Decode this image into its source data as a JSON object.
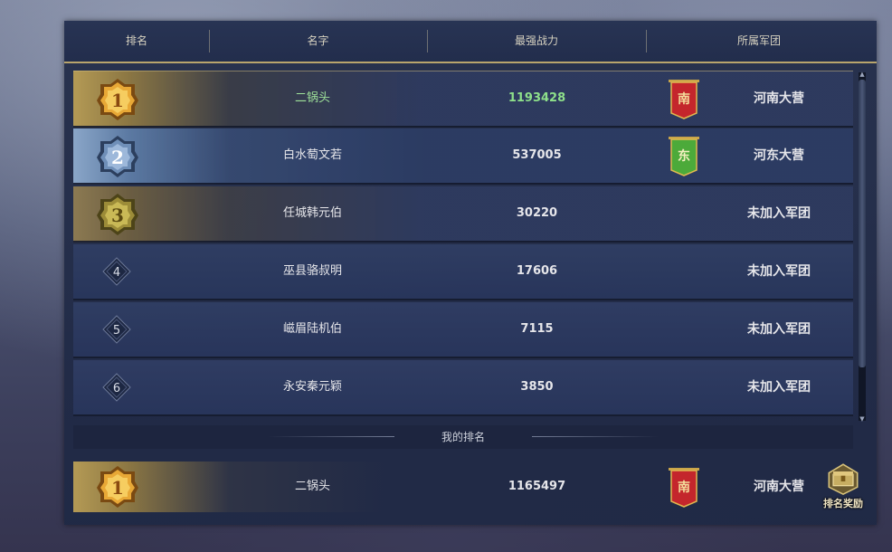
{
  "header": {
    "rank": "排名",
    "name": "名字",
    "power": "最强战力",
    "legion": "所属军团"
  },
  "rows": [
    {
      "rank": "1",
      "name": "二锅头",
      "power": "1193428",
      "legion": "河南大营",
      "flag_char": "南",
      "flag_color": "#c4262c",
      "medal": "gold"
    },
    {
      "rank": "2",
      "name": "白水萄文若",
      "power": "537005",
      "legion": "河东大营",
      "flag_char": "东",
      "flag_color": "#4caa3a",
      "medal": "silver"
    },
    {
      "rank": "3",
      "name": "任城韩元伯",
      "power": "30220",
      "legion": "未加入军团",
      "medal": "bronze"
    },
    {
      "rank": "4",
      "name": "巫县骆叔明",
      "power": "17606",
      "legion": "未加入军团"
    },
    {
      "rank": "5",
      "name": "嵫眉陆机伯",
      "power": "7115",
      "legion": "未加入军团"
    },
    {
      "rank": "6",
      "name": "永安秦元颖",
      "power": "3850",
      "legion": "未加入军团"
    }
  ],
  "my_rank": {
    "label": "我的排名",
    "rank": "1",
    "name": "二锅头",
    "power": "1165497",
    "legion": "河南大营",
    "flag_char": "南"
  },
  "reward_button": {
    "label": "排名奖励"
  },
  "colors": {
    "gold": "#d9a63b",
    "silver": "#7fa0c8",
    "bronze": "#b6a24e",
    "highlight_power": "#8ee08a"
  }
}
